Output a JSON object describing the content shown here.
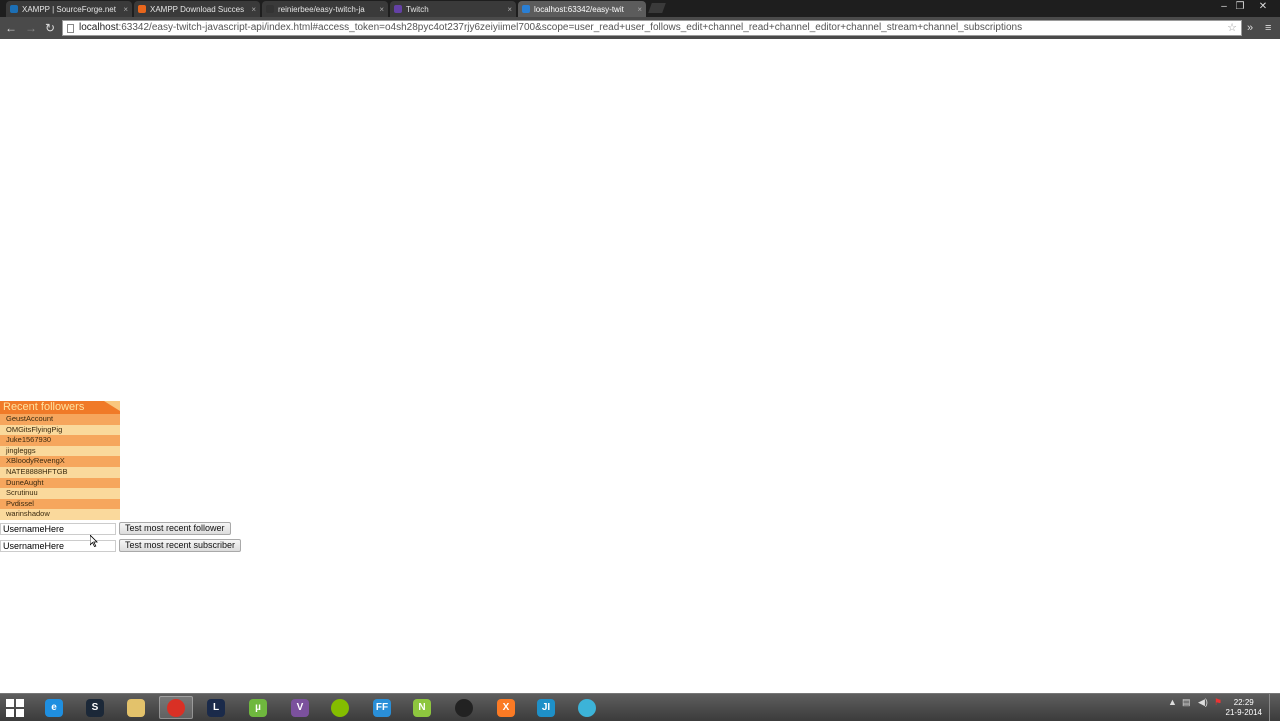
{
  "browser": {
    "tabs": [
      {
        "title": "XAMPP | SourceForge.net",
        "icon_color": "#1c6fb5"
      },
      {
        "title": "XAMPP Download Succes",
        "icon_color": "#e8661c"
      },
      {
        "title": "reinierbee/easy-twitch-ja",
        "icon_color": "#333333"
      },
      {
        "title": "Twitch",
        "icon_color": "#6441a5"
      },
      {
        "title": "localhost:63342/easy-twit",
        "icon_color": "#2a7fd4"
      }
    ],
    "url_host": "localhost",
    "url_rest": ":63342/easy-twitch-javascript-api/index.html#access_token=o4sh28pyc4ot237rjy6zeiyiimel700&scope=user_read+user_follows_edit+channel_read+channel_editor+channel_stream+channel_subscriptions"
  },
  "followers": {
    "title": "Recent followers",
    "items": [
      "GeustAccount",
      "OMGitsFlyingPig",
      "Juke1567930",
      "jingleggs",
      "XBloodyRevengX",
      "NATE8888HFTGB",
      "DuneAught",
      "Scrutinuu",
      "Pvdissel",
      "warinshadow"
    ]
  },
  "forms": {
    "follower_value": "UsernameHere",
    "follower_button": "Test most recent follower",
    "subscriber_value": "UsernameHere",
    "subscriber_button": "Test most recent subscriber"
  },
  "taskbar": {
    "apps": [
      {
        "name": "internet-explorer",
        "glyph": "e",
        "color": "#1f8fe0"
      },
      {
        "name": "steam",
        "glyph": "S",
        "color": "#1b2838"
      },
      {
        "name": "file-explorer",
        "glyph": "",
        "color": "#e3c26b"
      },
      {
        "name": "chrome",
        "glyph": "",
        "color": "#d93025"
      },
      {
        "name": "league-of-legends",
        "glyph": "L",
        "color": "#1a2a4a"
      },
      {
        "name": "utorrent",
        "glyph": "µ",
        "color": "#6fb83e"
      },
      {
        "name": "viber",
        "glyph": "V",
        "color": "#7b519d"
      },
      {
        "name": "spotify",
        "glyph": "",
        "color": "#84bd00"
      },
      {
        "name": "ff-app",
        "glyph": "FF",
        "color": "#2a8fd8"
      },
      {
        "name": "notepad-plus",
        "glyph": "N",
        "color": "#8ec63f"
      },
      {
        "name": "obs",
        "glyph": "",
        "color": "#222222"
      },
      {
        "name": "xampp",
        "glyph": "X",
        "color": "#fb7a24"
      },
      {
        "name": "webstorm",
        "glyph": "JI",
        "color": "#1e90c8"
      },
      {
        "name": "network-app",
        "glyph": "",
        "color": "#3cb3d8"
      }
    ],
    "time": "22:29",
    "date": "21-9-2014"
  }
}
